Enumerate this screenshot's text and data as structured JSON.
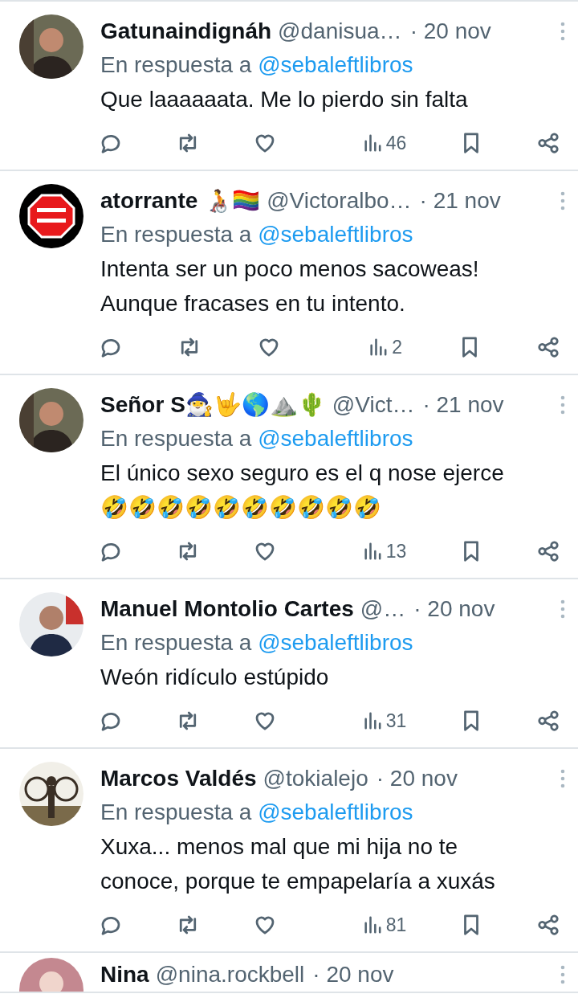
{
  "replies": [
    {
      "avatar": {
        "kind": "picture"
      },
      "name": "Gatunaindignáh",
      "handle": "@danisua…",
      "date": "· 20 nov",
      "reply_prefix": "En respuesta a",
      "reply_to": "@sebaleftlibros",
      "text": [
        "Que laaaaaata. Me lo pierdo sin falta"
      ],
      "views": "46"
    },
    {
      "avatar": {
        "kind": "picture"
      },
      "name": "atorrante 🧑‍🦽🏳️‍🌈",
      "handle": "@Victoralbo…",
      "date": "· 21 nov",
      "reply_prefix": "En respuesta a",
      "reply_to": "@sebaleftlibros",
      "text": [
        "Intenta ser un poco menos sacoweas!",
        "Aunque fracases en tu intento."
      ],
      "views": "2"
    },
    {
      "avatar": {
        "kind": "picture"
      },
      "name": "Señor S🧙‍♂️🤟🌎⛰️🌵",
      "handle": "@Vict…",
      "date": "· 21 nov",
      "reply_prefix": "En respuesta a",
      "reply_to": "@sebaleftlibros",
      "text": [
        "El único sexo seguro es el q nose ejerce",
        "🤣🤣🤣🤣🤣🤣🤣🤣🤣🤣"
      ],
      "views": "13"
    },
    {
      "avatar": {
        "kind": "picture"
      },
      "name": "Manuel Montolio Cartes",
      "handle": "@…",
      "date": "· 20 nov",
      "reply_prefix": "En respuesta a",
      "reply_to": "@sebaleftlibros",
      "text": [
        "Weón ridículo estúpido"
      ],
      "views": "31"
    },
    {
      "avatar": {
        "kind": "picture"
      },
      "name": "Marcos Valdés",
      "handle": "@tokialejo",
      "date": "· 20 nov",
      "reply_prefix": "En respuesta a",
      "reply_to": "@sebaleftlibros",
      "text": [
        "Xuxa... menos mal que mi hija no te",
        "conoce, porque te empapelaría a xuxás"
      ],
      "views": "81"
    }
  ],
  "partial_reply": {
    "avatar": {
      "kind": "picture"
    },
    "name": "Nina",
    "handle": "@nina.rockbell",
    "date": "· 20 nov"
  }
}
